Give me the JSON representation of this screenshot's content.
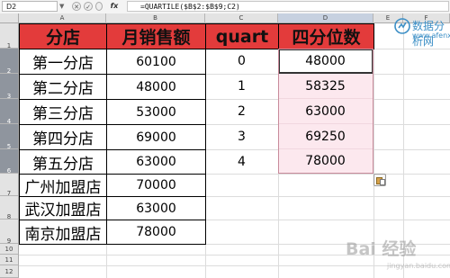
{
  "formula_bar": {
    "cell_ref": "D2",
    "fx_label": "fx",
    "formula": "=QUARTILE($B$2:$B$9;C2)"
  },
  "columns": [
    "A",
    "B",
    "C",
    "D",
    "E",
    "F"
  ],
  "rows": [
    "1",
    "2",
    "3",
    "4",
    "5",
    "6",
    "7",
    "8",
    "9",
    "10",
    "11",
    "12"
  ],
  "headers": [
    "分店",
    "月销售额",
    "quart",
    "四分位数"
  ],
  "shops": [
    {
      "name": "第一分店",
      "sales": "60100"
    },
    {
      "name": "第二分店",
      "sales": "48000"
    },
    {
      "name": "第三分店",
      "sales": "53000"
    },
    {
      "name": "第四分店",
      "sales": "69000"
    },
    {
      "name": "第五分店",
      "sales": "63000"
    },
    {
      "name": "广州加盟店",
      "sales": "70000"
    },
    {
      "name": "武汉加盟店",
      "sales": "63000"
    },
    {
      "name": "南京加盟店",
      "sales": "78000"
    }
  ],
  "quartiles": [
    {
      "quart": "0",
      "value": "48000"
    },
    {
      "quart": "1",
      "value": "58325"
    },
    {
      "quart": "2",
      "value": "63000"
    },
    {
      "quart": "3",
      "value": "69250"
    },
    {
      "quart": "4",
      "value": "78000"
    }
  ],
  "watermark": {
    "site_name": "数据分析网",
    "site_url": "www.afenxi.com",
    "baidu": "Bai 经验",
    "baidu_url": "jingyan.baidu.com"
  },
  "colors": {
    "header_fill": "#e33b3b",
    "result_fill": "#fce8ee",
    "selected_row_header": "#8f959e"
  }
}
